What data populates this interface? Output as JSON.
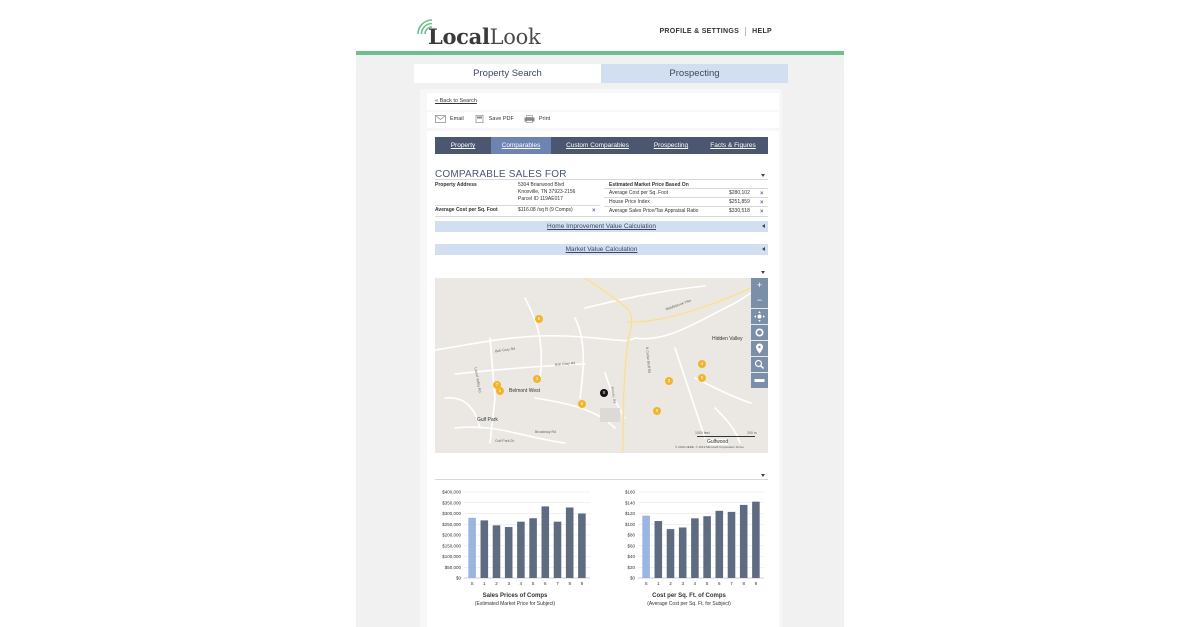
{
  "header": {
    "logo_light": "Local",
    "logo_bold": "Look",
    "links": [
      "PROFILE & SETTINGS",
      "HELP"
    ]
  },
  "main_tabs": [
    {
      "label": "Property Search",
      "active": true
    },
    {
      "label": "Prospecting",
      "active": false
    }
  ],
  "back_link": "« Back to Search",
  "actions": [
    {
      "label": "Email",
      "icon": "email-icon"
    },
    {
      "label": "Save PDF",
      "icon": "pdf-icon"
    },
    {
      "label": "Print",
      "icon": "print-icon"
    }
  ],
  "subnav": [
    {
      "label": "Property",
      "active": false
    },
    {
      "label": "Comparables",
      "active": true
    },
    {
      "label": "Custom Comparables",
      "active": false
    },
    {
      "label": "Prospecting",
      "active": false
    },
    {
      "label": "Facts & Figures",
      "active": false
    }
  ],
  "comparables": {
    "title": "COMPARABLE SALES FOR",
    "property_address_label": "Property Address",
    "address_lines": [
      "5304 Briarwood Blvd",
      "Knoxville, TN 37923-2156",
      "Parcel ID 119AE017"
    ],
    "avg_cost_label": "Average Cost per Sq. Foot",
    "avg_cost_value": "$116.08 /sq ft (9 Comps)",
    "estimate_header": "Estimated Market Price Based On",
    "estimates": [
      {
        "label": "Average Cost per Sq. Foot",
        "value": "$280,102"
      },
      {
        "label": "House Price Index",
        "value": "$251,859"
      },
      {
        "label": "Average Sales Price/Tax Appraisal Ratio",
        "value": "$330,518"
      }
    ],
    "home_improvement": "Home Improvement Value Calculation",
    "market_value": "Market Value Calculation"
  },
  "map": {
    "places": [
      "Hidden Valley",
      "Belmont West",
      "Gulf Park",
      "Gulfwood"
    ],
    "streets": [
      "Bob Gray Rd",
      "N Cedar Bluff Rd",
      "Ponder Rd",
      "Broadway Rd",
      "Gulf Park Dr",
      "Bob Gray Rd",
      "Laurel Valley Rd",
      "Middlebrook Pike"
    ],
    "scale_labels": [
      "1000 feet",
      "200 m"
    ],
    "attribution": "© 2019 HERE, © 2019 Microsoft Corporation  Terms",
    "controls": [
      "+",
      "−"
    ],
    "pins": [
      {
        "label": "8"
      },
      {
        "label": "4"
      },
      {
        "label": "6"
      },
      {
        "label": "2"
      },
      {
        "label": "3"
      },
      {
        "label": "7"
      },
      {
        "label": "1"
      },
      {
        "label": "5"
      },
      {
        "label": "9"
      }
    ],
    "subject_label": "S"
  },
  "chart_data": [
    {
      "type": "bar",
      "title": "Sales Prices of Comps",
      "subtitle": "(Estimated Market Price for Subject)",
      "categories": [
        "S",
        "1",
        "2",
        "3",
        "4",
        "5",
        "6",
        "7",
        "8",
        "9"
      ],
      "values": [
        280000,
        268000,
        245000,
        237000,
        262000,
        278000,
        333000,
        262000,
        328000,
        300000
      ],
      "y_ticks": [
        "$0",
        "$50,000",
        "$100,000",
        "$150,000",
        "$200,000",
        "$250,000",
        "$300,000",
        "$350,000",
        "$400,000"
      ],
      "ylim": [
        0,
        400000
      ],
      "grid": true,
      "colors": {
        "subject": "#9ab6e0",
        "comps": "#5f6b80"
      }
    },
    {
      "type": "bar",
      "title": "Cost per Sq. Ft. of Comps",
      "subtitle": "(Average Cost per Sq. Ft. for Subject)",
      "categories": [
        "S",
        "1",
        "2",
        "3",
        "4",
        "5",
        "6",
        "7",
        "8",
        "9"
      ],
      "values": [
        116,
        106,
        91,
        94,
        111,
        115,
        125,
        123,
        136,
        142
      ],
      "y_ticks": [
        "$0",
        "$20",
        "$40",
        "$60",
        "$80",
        "$100",
        "$120",
        "$140",
        "$160"
      ],
      "ylim": [
        0,
        160
      ],
      "grid": true,
      "colors": {
        "subject": "#9ab6e0",
        "comps": "#5f6b80"
      }
    }
  ]
}
